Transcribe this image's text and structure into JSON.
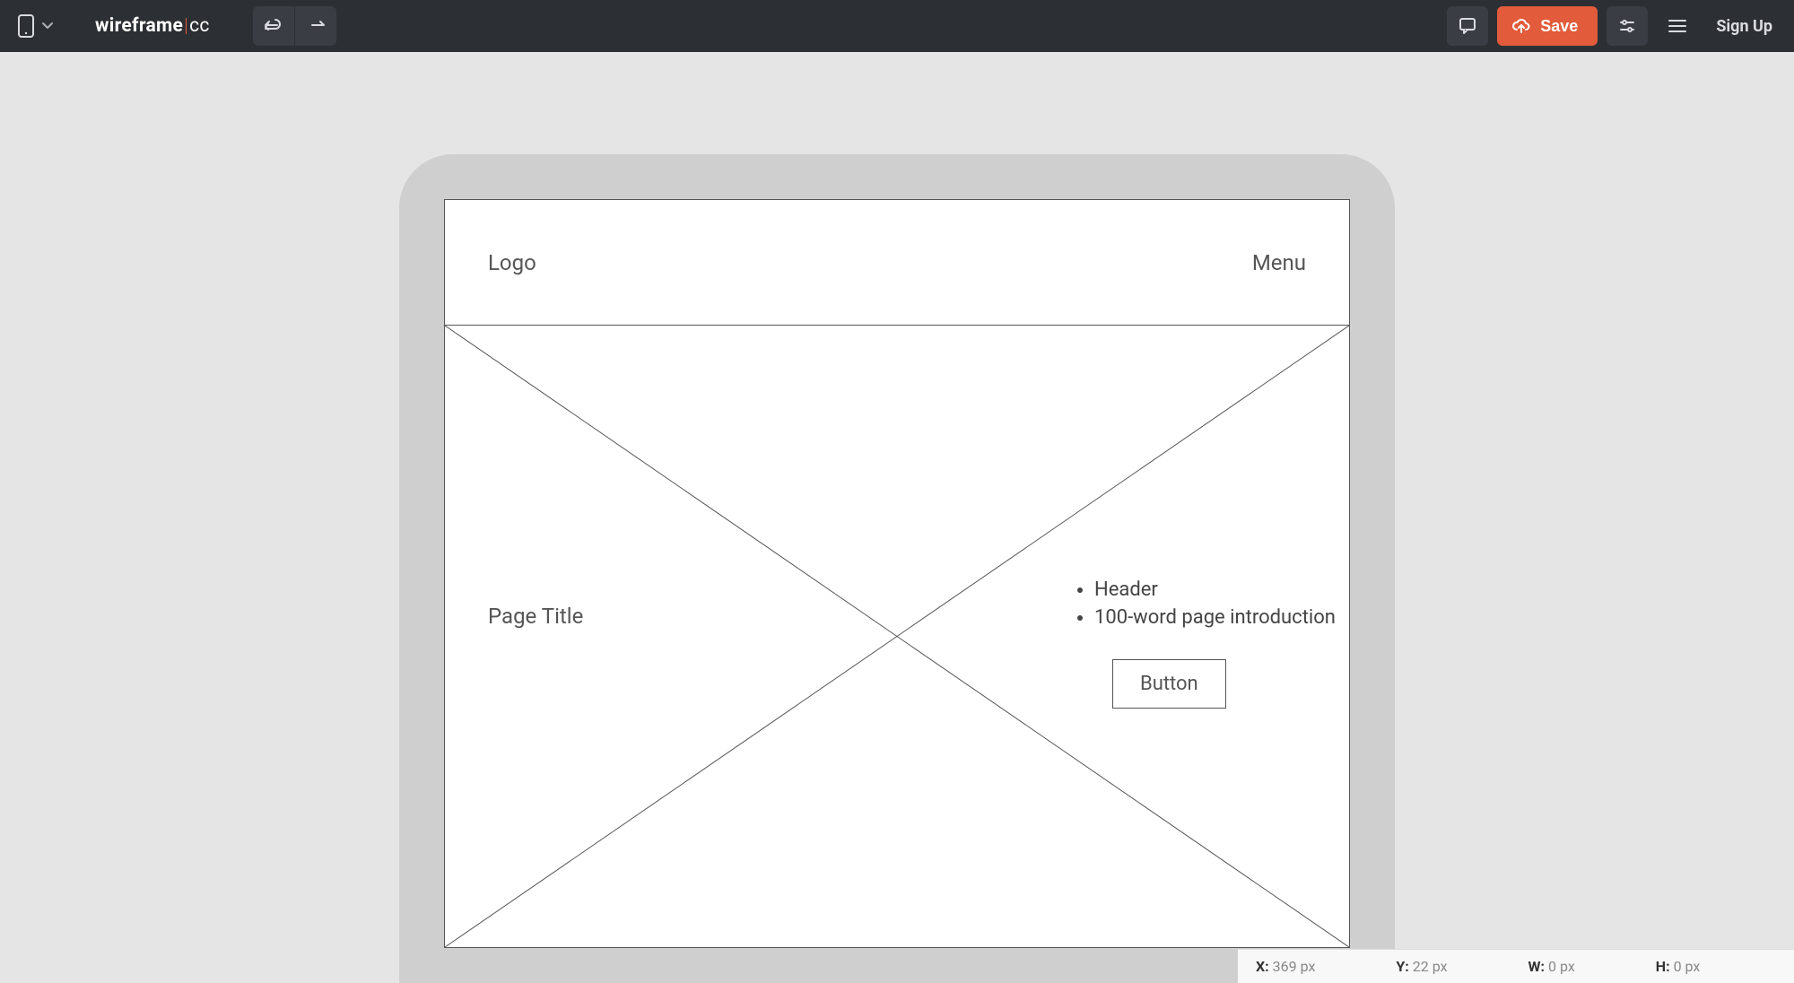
{
  "brand": {
    "part1": "wireframe",
    "part2": "cc"
  },
  "toolbar": {
    "save_label": "Save",
    "signup_label": "Sign Up"
  },
  "wireframe": {
    "header": {
      "logo_label": "Logo",
      "menu_label": "Menu"
    },
    "hero": {
      "page_title": "Page Title",
      "bullets": [
        "Header",
        "100-word page introduction"
      ],
      "button_label": "Button"
    }
  },
  "status": {
    "x_label": "X:",
    "x_value": "369 px",
    "y_label": "Y:",
    "y_value": "22 px",
    "w_label": "W:",
    "w_value": "0 px",
    "h_label": "H:",
    "h_value": "0 px"
  }
}
